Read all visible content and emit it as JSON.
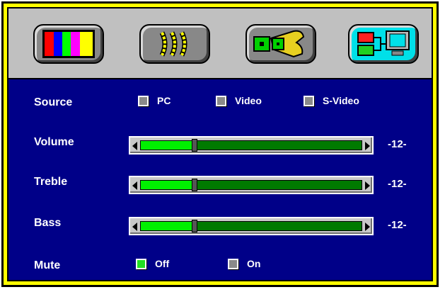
{
  "tabs": [
    {
      "name": "color-bars-icon",
      "active": false
    },
    {
      "name": "waves-icon",
      "active": false
    },
    {
      "name": "wrench-icon",
      "active": false
    },
    {
      "name": "computer-io-icon",
      "active": true
    }
  ],
  "source": {
    "label": "Source",
    "options": [
      {
        "label": "PC",
        "checked": false
      },
      {
        "label": "Video",
        "checked": false
      },
      {
        "label": "S-Video",
        "checked": false
      }
    ]
  },
  "volume": {
    "label": "Volume",
    "value": "-12-",
    "fraction": 0.24
  },
  "treble": {
    "label": "Treble",
    "value": "-12-",
    "fraction": 0.24
  },
  "bass": {
    "label": "Bass",
    "value": "-12-",
    "fraction": 0.24
  },
  "mute": {
    "label": "Mute",
    "options": [
      {
        "label": "Off",
        "checked": true
      },
      {
        "label": "On",
        "checked": false
      }
    ]
  },
  "colors": {
    "background": "#000088",
    "frame": "#ffff00",
    "active_tab": "#00e0e8",
    "track": "#007a00",
    "fill": "#00f000"
  }
}
